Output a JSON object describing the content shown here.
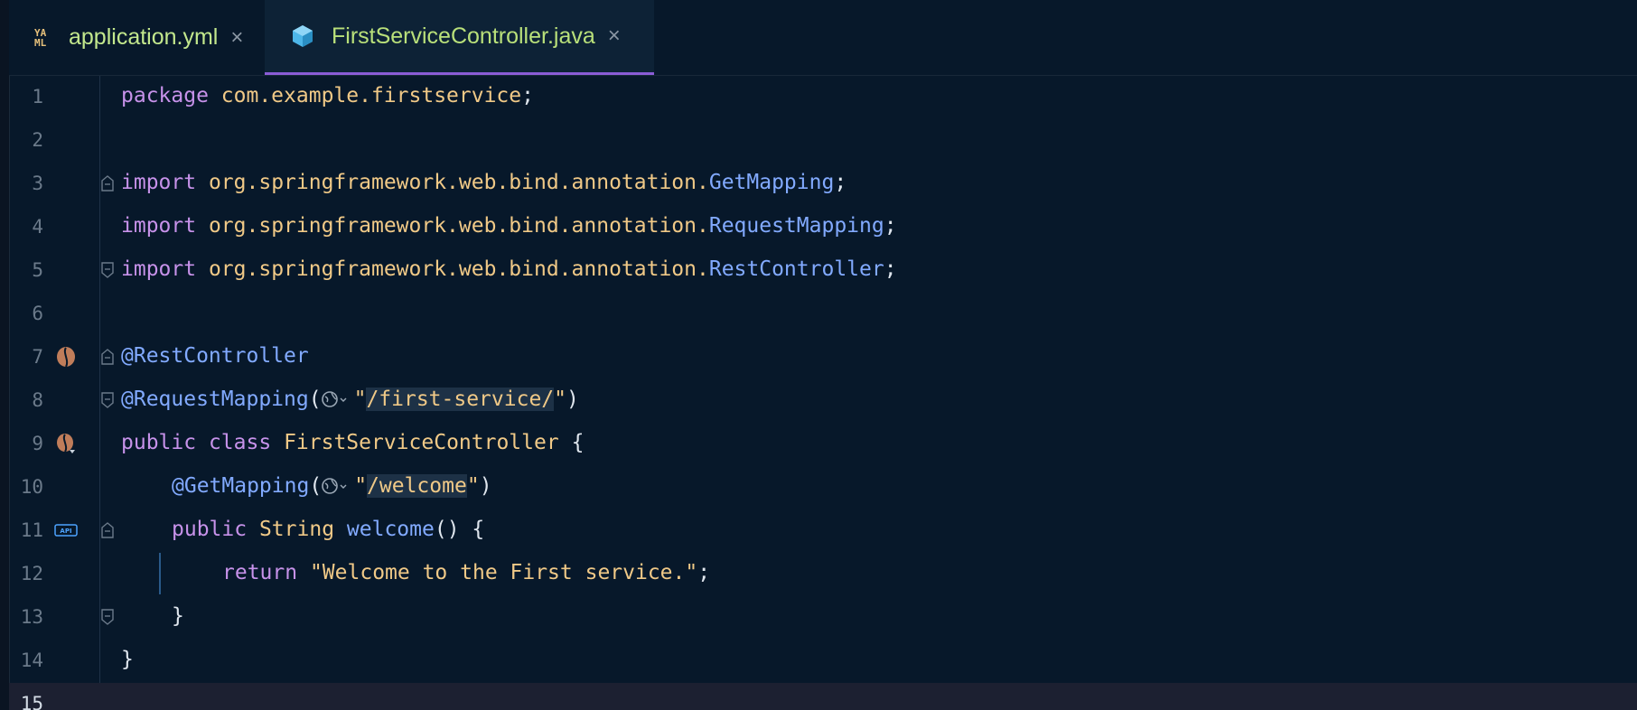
{
  "tabs": [
    {
      "label": "application.yml",
      "icon": "yaml-icon",
      "active": false
    },
    {
      "label": "FirstServiceController.java",
      "icon": "java-class-icon",
      "active": true
    }
  ],
  "yaml_icon_text": {
    "top": "YA",
    "bottom": "ML"
  },
  "close_glyph": "×",
  "line_numbers": [
    "1",
    "2",
    "3",
    "4",
    "5",
    "6",
    "7",
    "8",
    "9",
    "10",
    "11",
    "12",
    "13",
    "14",
    "15"
  ],
  "code": {
    "l1": {
      "kw": "package",
      "pkg": "com.example.firstservice",
      "end": ";"
    },
    "l3": {
      "kw": "import",
      "pkg": "org.springframework.web.bind.annotation.",
      "cls": "GetMapping",
      "end": ";"
    },
    "l4": {
      "kw": "import",
      "pkg": "org.springframework.web.bind.annotation.",
      "cls": "RequestMapping",
      "end": ";"
    },
    "l5": {
      "kw": "import",
      "pkg": "org.springframework.web.bind.annotation.",
      "cls": "RestController",
      "end": ";"
    },
    "l7": {
      "ann": "@RestController"
    },
    "l8": {
      "ann": "@RequestMapping",
      "open": "(",
      "q1": "\"",
      "path": "/first-service/",
      "q2": "\"",
      "close": ")"
    },
    "l9": {
      "kw1": "public",
      "kw2": "class",
      "name": "FirstServiceController",
      "brace": "{"
    },
    "l10": {
      "ann": "@GetMapping",
      "open": "(",
      "q1": "\"",
      "path": "/welcome",
      "q2": "\"",
      "close": ")"
    },
    "l11": {
      "kw": "public",
      "type": "String",
      "meth": "welcome",
      "rest": "() {"
    },
    "l12": {
      "kw": "return",
      "str": "\"Welcome to the First service.\"",
      "end": ";"
    },
    "l13": {
      "brace": "}"
    },
    "l14": {
      "brace": "}"
    }
  },
  "colors": {
    "background": "#07182a",
    "keyword": "#c792ea",
    "package": "#f0c987",
    "class_ref": "#82aaff",
    "string": "#f0c987",
    "active_tab_underline": "#8a5cd6",
    "current_line": "#1c2031"
  },
  "gutter_icons": [
    {
      "line": "7",
      "icon": "spring-bean-icon"
    },
    {
      "line": "9",
      "icon": "spring-bean-navigate-icon"
    },
    {
      "line": "11",
      "icon": "api-endpoint-icon"
    }
  ],
  "inline_icons": [
    {
      "line": "8",
      "icon": "globe-url-icon"
    },
    {
      "line": "10",
      "icon": "globe-url-icon"
    }
  ]
}
